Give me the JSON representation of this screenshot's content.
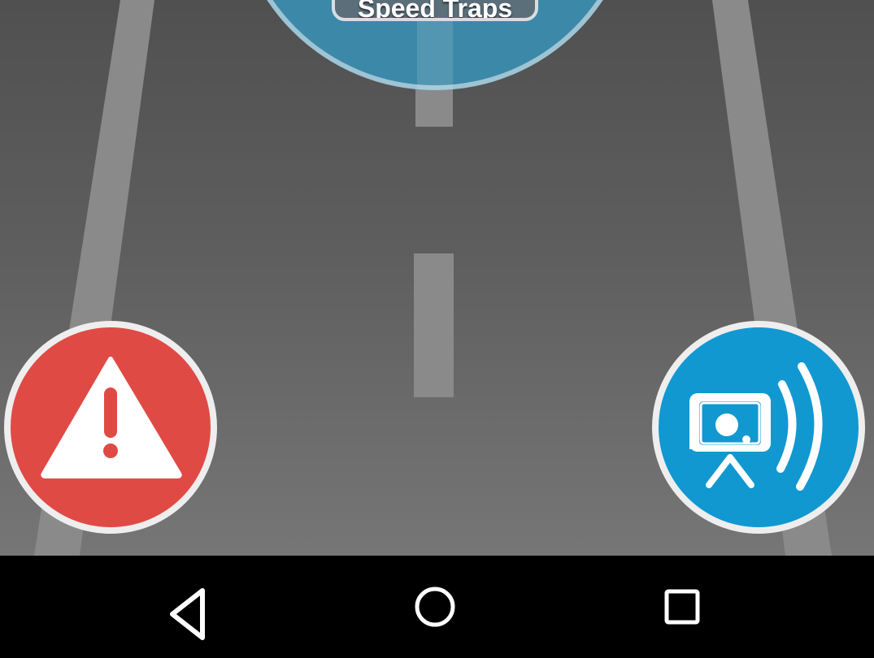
{
  "screen": {
    "banner_label": "Speed Traps"
  },
  "buttons": {
    "hazard_report": {
      "icon": "warning-triangle-icon",
      "color": "#e04a45"
    },
    "speed_camera_report": {
      "icon": "speed-camera-icon",
      "color": "#1198d1"
    }
  },
  "navigation_bar": {
    "back": {
      "icon": "back-triangle-icon"
    },
    "home": {
      "icon": "home-circle-icon"
    },
    "recents": {
      "icon": "recents-square-icon"
    }
  },
  "colors": {
    "road": "#5e5e5e",
    "lane_marking": "#8a8a8a",
    "banner": "#3c88a8",
    "nav_bar": "#000000"
  }
}
